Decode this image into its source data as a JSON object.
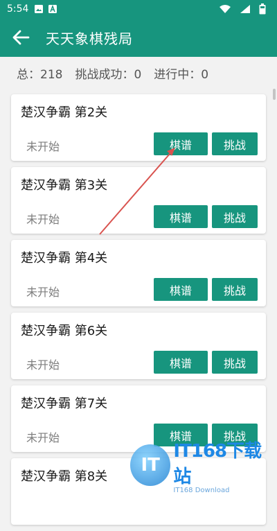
{
  "status_bar": {
    "time": "5:54",
    "icons_left": [
      "image-icon",
      "a-badge-icon"
    ],
    "icons_right": [
      "wifi-icon",
      "signal-icon",
      "battery-icon"
    ]
  },
  "app_bar": {
    "title": "天天象棋残局",
    "back_icon": "arrow-left-icon"
  },
  "stats": {
    "total": "总：218",
    "success": "挑战成功：0",
    "in_progress": "进行中：0"
  },
  "levels": [
    {
      "title": "楚汉争霸 第2关",
      "status": "未开始",
      "qipu": "棋谱",
      "challenge": "挑战"
    },
    {
      "title": "楚汉争霸 第3关",
      "status": "未开始",
      "qipu": "棋谱",
      "challenge": "挑战"
    },
    {
      "title": "楚汉争霸 第4关",
      "status": "未开始",
      "qipu": "棋谱",
      "challenge": "挑战"
    },
    {
      "title": "楚汉争霸 第6关",
      "status": "未开始",
      "qipu": "棋谱",
      "challenge": "挑战"
    },
    {
      "title": "楚汉争霸 第7关",
      "status": "未开始",
      "qipu": "棋谱",
      "challenge": "挑战"
    },
    {
      "title": "楚汉争霸 第8关",
      "status": "",
      "qipu": "",
      "challenge": ""
    }
  ],
  "watermark": {
    "badge": "IT",
    "main": "IT168下载站",
    "sub": "IT168 Download"
  },
  "colors": {
    "primary": "#17957e",
    "annotation_arrow": "#d9534f"
  }
}
